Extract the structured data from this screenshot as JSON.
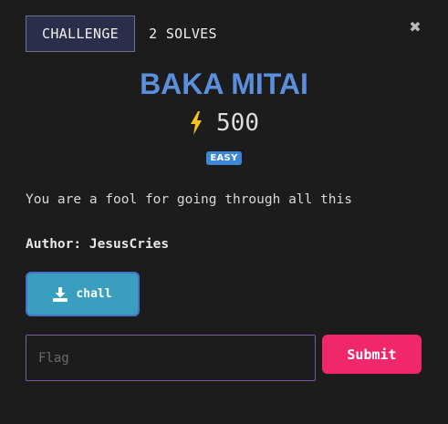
{
  "tabs": [
    {
      "label": "CHALLENGE",
      "active": true
    },
    {
      "label": "2 SOLVES",
      "active": false
    }
  ],
  "close": {
    "icon": "close-icon",
    "glyph": "✖"
  },
  "challenge": {
    "name": "BAKA MITAI",
    "points": "500",
    "points_icon": "lightning-bolt-icon",
    "difficulty": "EASY",
    "description": "You are a fool for going through all this",
    "author": "Author: JesusCries"
  },
  "download": {
    "label": "chall",
    "icon": "download-icon"
  },
  "flag": {
    "placeholder": "Flag",
    "value": ""
  },
  "submit": {
    "label": "Submit"
  },
  "colors": {
    "title": "#5b8edb",
    "badge": "#3e86d8",
    "download_button": "#3a9fbe",
    "submit_button": "#f0276a",
    "active_tab": "#2b2e4a",
    "bolt": "#f5c518"
  }
}
